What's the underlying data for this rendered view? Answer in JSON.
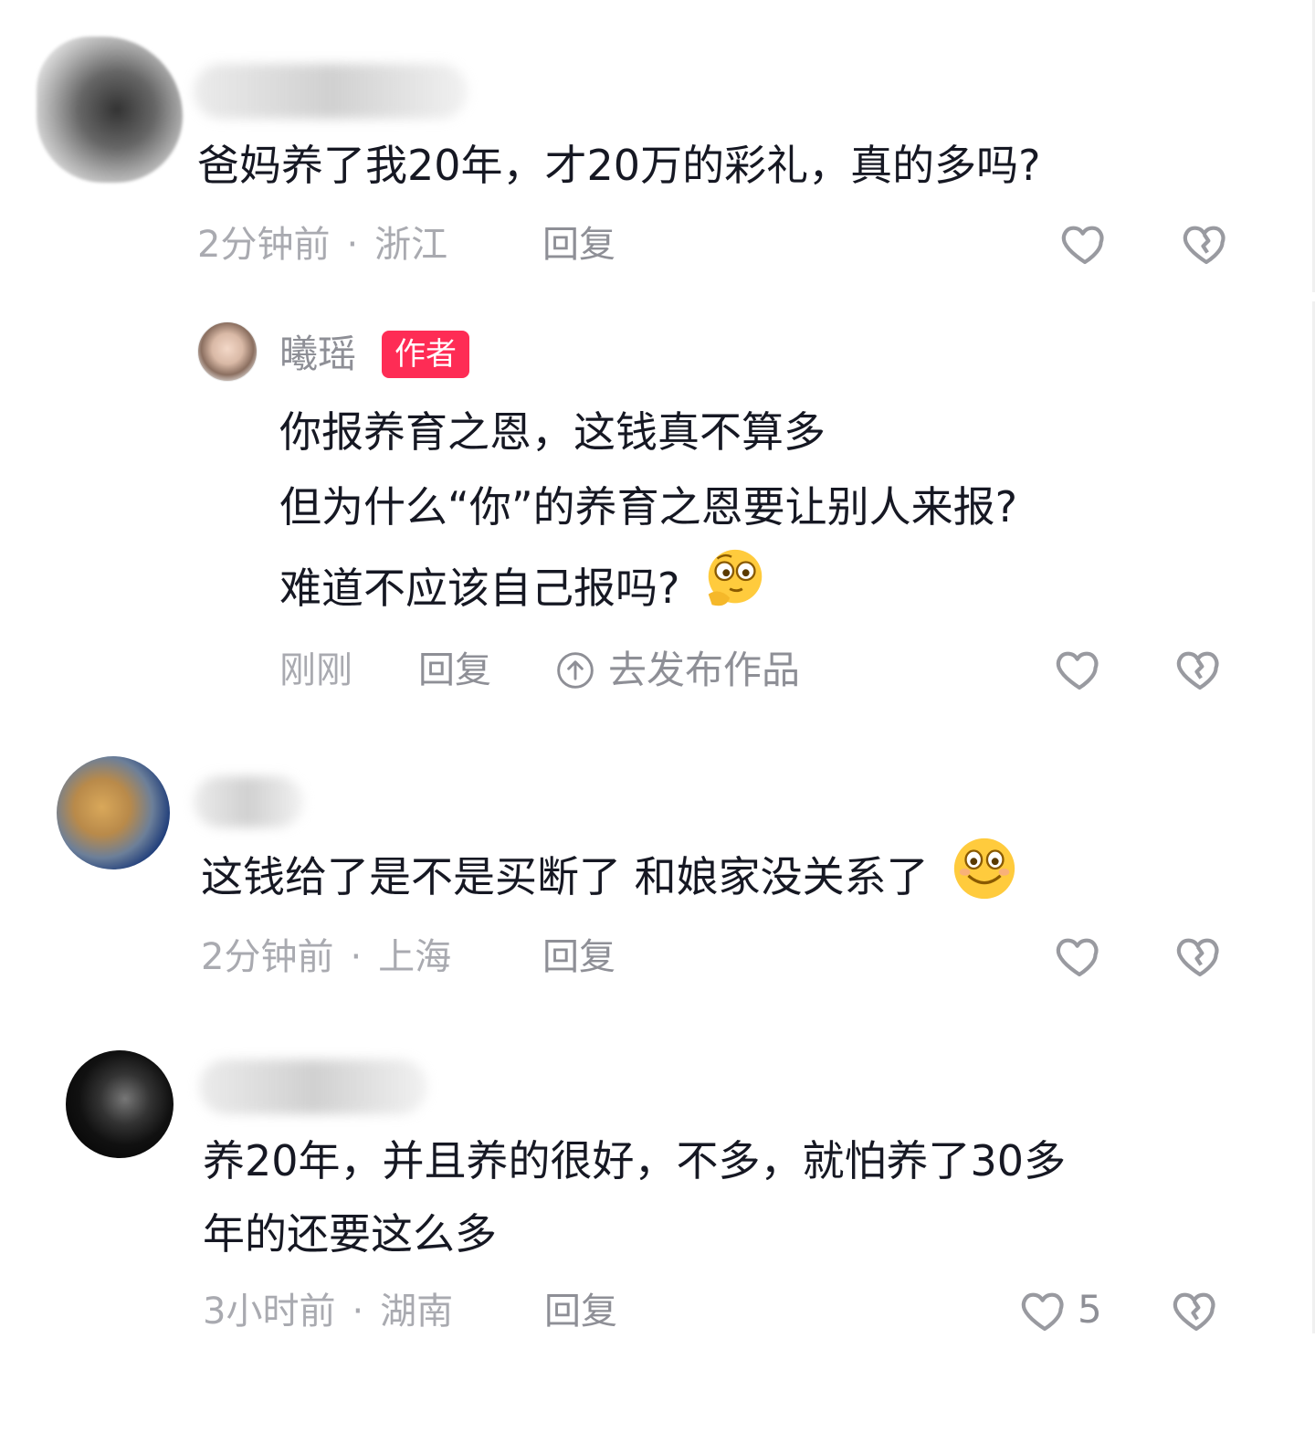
{
  "comments": [
    {
      "text": "爸妈养了我20年，才20万的彩礼，真的多吗?",
      "time": "2分钟前",
      "location": "浙江",
      "reply_label": "回复"
    },
    {
      "author": "曦瑶",
      "badge": "作者",
      "lines": [
        "你报养育之恩，这钱真不算多",
        "但为什么“你”的养育之恩要让别人来报?",
        "难道不应该自己报吗?"
      ],
      "time": "刚刚",
      "reply_label": "回复",
      "publish_label": "去发布作品"
    },
    {
      "text": "这钱给了是不是买断了 和娘家没关系了",
      "time": "2分钟前",
      "location": "上海",
      "reply_label": "回复"
    },
    {
      "lines": [
        "养20年，并且养的很好，不多，就怕养了30多",
        "年的还要这么多"
      ],
      "time": "3小时前",
      "location": "湖南",
      "reply_label": "回复",
      "likes": "5"
    }
  ],
  "colors": {
    "badge": "#fe2c55",
    "meta": "#a9aab0",
    "text": "#161823"
  },
  "icons": [
    "heart-outline-icon",
    "broken-heart-icon",
    "upload-circle-icon",
    "thinking-emoji-icon",
    "smile-emoji-icon"
  ]
}
